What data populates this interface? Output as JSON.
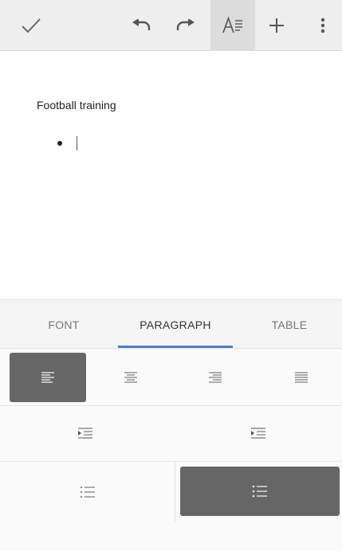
{
  "toolbar": {
    "icons": [
      "check-icon",
      "undo-icon",
      "redo-icon",
      "text-format-icon",
      "add-icon",
      "more-vert-icon"
    ]
  },
  "document": {
    "title": "Football training",
    "bullet_items": [
      ""
    ]
  },
  "tabs": [
    {
      "label": "FONT",
      "active": false
    },
    {
      "label": "PARAGRAPH",
      "active": true
    },
    {
      "label": "TABLE",
      "active": false
    }
  ],
  "paragraph_panel": {
    "alignment_selected": "left",
    "list_selected": "bulleted"
  },
  "colors": {
    "toolbar_bg": "#eeeeee",
    "tab_indicator": "#4a80c4",
    "selected_button": "#666666"
  }
}
